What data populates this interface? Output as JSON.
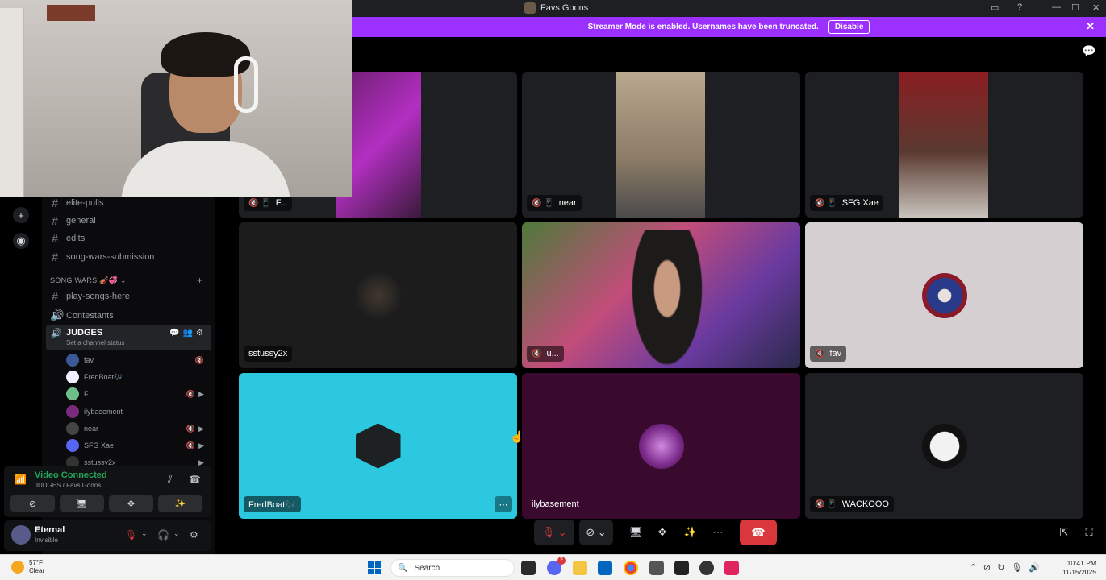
{
  "window": {
    "title": "Favs Goons"
  },
  "banner": {
    "text": "Streamer Mode is enabled. Usernames have been truncated.",
    "disable_label": "Disable"
  },
  "channels": {
    "text": [
      "elite-pulls",
      "general",
      "edits",
      "song-wars-submission"
    ],
    "category": "SONG WARS 🎻💞",
    "song_wars": [
      "play-songs-here"
    ],
    "voice": [
      "Contestants"
    ],
    "active_voice": {
      "name": "JUDGES",
      "status": "Set a channel status"
    },
    "members": [
      "fav",
      "FredBoat🎶",
      "F...",
      "ilybasement",
      "near",
      "SFG Xae",
      "sstussy2x"
    ]
  },
  "voice_panel": {
    "title": "Video Connected",
    "subtitle": "JUDGES / Favs Goons"
  },
  "user_panel": {
    "name": "Eternal",
    "status": "Invisible"
  },
  "tiles": [
    {
      "label": "F...",
      "icons": "🔇 📱"
    },
    {
      "label": "near",
      "icons": "🔇 📱"
    },
    {
      "label": "SFG Xae",
      "icons": "🔇 📱"
    },
    {
      "label": "sstussy2x",
      "icons": ""
    },
    {
      "label": "u...",
      "icons": "🔇"
    },
    {
      "label": "fav",
      "icons": "🔇"
    },
    {
      "label": "FredBoat🎶",
      "icons": ""
    },
    {
      "label": "ilybasement",
      "icons": ""
    },
    {
      "label": "WACKOOO",
      "icons": "🔇 📱"
    }
  ],
  "taskbar": {
    "weather_temp": "57°F",
    "weather_cond": "Clear",
    "search_placeholder": "Search",
    "time": "10:41 PM",
    "date": "11/15/2025",
    "discord_badge": "2"
  },
  "colors": {
    "accent_banner": "#9b30ff",
    "connected": "#23a55a",
    "hangup": "#da373c"
  }
}
